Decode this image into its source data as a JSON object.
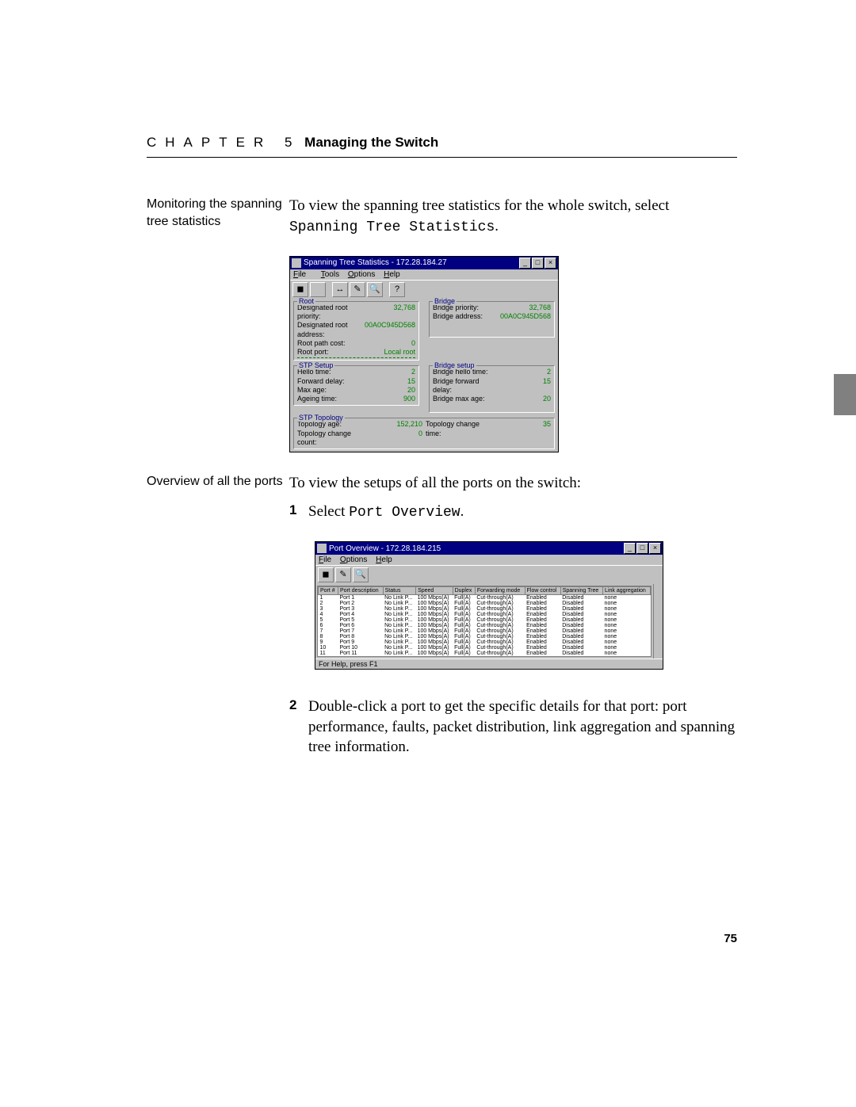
{
  "header": {
    "chapter_label": "CHAPTER 5",
    "chapter_title": "Managing the Switch"
  },
  "page_number": "75",
  "sec1": {
    "margin": "Monitoring the spanning tree statistics",
    "body": "To view the spanning tree statistics for the whole switch, select ",
    "mono": "Spanning Tree Statistics",
    "period": "."
  },
  "sec2": {
    "margin": "Overview of all the ports",
    "body": "To view the setups of all the ports on the switch:",
    "step1a": "Select ",
    "step1mono": "Port Overview",
    "step1b": ".",
    "step2": "Double-click a port to get the specific details for that port: port performance, faults, packet distribution, link aggregation and spanning tree information."
  },
  "win1": {
    "title": "Spanning Tree Statistics - 172.28.184.27",
    "menu": {
      "file": "File",
      "tools": "Tools",
      "options": "Options",
      "help": "Help"
    },
    "root": {
      "title": "Root",
      "r1l": "Designated root priority:",
      "r1v": "32,768",
      "r2l": "Designated root address:",
      "r2v": "00A0C945D568",
      "r3l": "Root path cost:",
      "r3v": "0",
      "r4l": "Root port:",
      "r4v": "Local root"
    },
    "bridge": {
      "title": "Bridge",
      "r1l": "Bridge priority:",
      "r1v": "32,768",
      "r2l": "Bridge address:",
      "r2v": "00A0C945D568"
    },
    "stpsetup": {
      "title": "STP Setup",
      "r1l": "Hello time:",
      "r1v": "2",
      "r2l": "Forward delay:",
      "r2v": "15",
      "r3l": "Max age:",
      "r3v": "20",
      "r4l": "Ageing time:",
      "r4v": "900"
    },
    "bridgesetup": {
      "title": "Bridge setup",
      "r1l": "Bridge hello time:",
      "r1v": "2",
      "r2l": "Bridge forward delay:",
      "r2v": "15",
      "r3l": "Bridge max age:",
      "r3v": "20"
    },
    "stptopo": {
      "title": "STP Topology",
      "r1l": "Topology age:",
      "r1v": "152,210",
      "r2l": "Topology change count:",
      "r2v": "0",
      "r3l": "Topology change time:",
      "r3v": "35"
    }
  },
  "win2": {
    "title": "Port Overview - 172.28.184.215",
    "menu": {
      "file": "File",
      "options": "Options",
      "help": "Help"
    },
    "status": "For Help, press F1",
    "headers": [
      "Port #",
      "Port description",
      "Status",
      "Speed",
      "Duplex",
      "Forwarding mode",
      "Flow control",
      "Spanning Tree",
      "Link aggregation"
    ],
    "rows": [
      [
        "1",
        "Port 1",
        "No Link P...",
        "100 Mbps(A)",
        "Full(A)",
        "Cut-through(A)",
        "Enabled",
        "Disabled",
        "none"
      ],
      [
        "2",
        "Port 2",
        "No Link P...",
        "100 Mbps(A)",
        "Full(A)",
        "Cut-through(A)",
        "Enabled",
        "Disabled",
        "none"
      ],
      [
        "3",
        "Port 3",
        "No Link P...",
        "100 Mbps(A)",
        "Full(A)",
        "Cut-through(A)",
        "Enabled",
        "Disabled",
        "none"
      ],
      [
        "4",
        "Port 4",
        "No Link P...",
        "100 Mbps(A)",
        "Full(A)",
        "Cut-through(A)",
        "Enabled",
        "Disabled",
        "none"
      ],
      [
        "5",
        "Port 5",
        "No Link P...",
        "100 Mbps(A)",
        "Full(A)",
        "Cut-through(A)",
        "Enabled",
        "Disabled",
        "none"
      ],
      [
        "6",
        "Port 6",
        "No Link P...",
        "100 Mbps(A)",
        "Full(A)",
        "Cut-through(A)",
        "Enabled",
        "Disabled",
        "none"
      ],
      [
        "7",
        "Port 7",
        "No Link P...",
        "100 Mbps(A)",
        "Full(A)",
        "Cut-through(A)",
        "Enabled",
        "Disabled",
        "none"
      ],
      [
        "8",
        "Port 8",
        "No Link P...",
        "100 Mbps(A)",
        "Full(A)",
        "Cut-through(A)",
        "Enabled",
        "Disabled",
        "none"
      ],
      [
        "9",
        "Port 9",
        "No Link P...",
        "100 Mbps(A)",
        "Full(A)",
        "Cut-through(A)",
        "Enabled",
        "Disabled",
        "none"
      ],
      [
        "10",
        "Port 10",
        "No Link P...",
        "100 Mbps(A)",
        "Full(A)",
        "Cut-through(A)",
        "Enabled",
        "Disabled",
        "none"
      ],
      [
        "11",
        "Port 11",
        "No Link P...",
        "100 Mbps(A)",
        "Full(A)",
        "Cut-through(A)",
        "Enabled",
        "Disabled",
        "none"
      ]
    ]
  }
}
